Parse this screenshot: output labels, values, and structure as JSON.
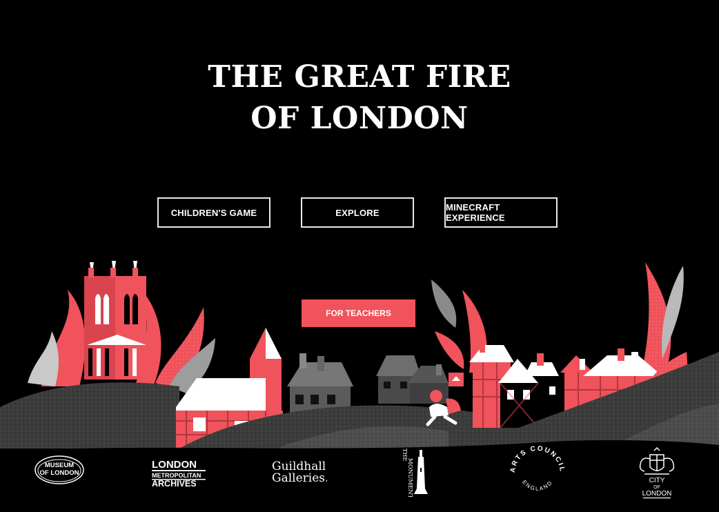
{
  "title": {
    "line1": "THE GREAT FIRE",
    "line2": "OF LONDON"
  },
  "nav": {
    "childrens_game": "CHILDREN'S GAME",
    "explore": "EXPLORE",
    "minecraft": "MINECRAFT EXPERIENCE"
  },
  "teachers": {
    "label": "FOR TEACHERS"
  },
  "colors": {
    "accent": "#f0535c",
    "background": "#000000",
    "hill": "#3a3a3a"
  },
  "logos": {
    "museum_line1": "MUSEUM",
    "museum_line2": "OF LONDON",
    "lma_line1": "LONDON",
    "lma_line2": "METROPOLITAN",
    "lma_line3": "ARCHIVES",
    "guildhall_line1": "Guildhall",
    "guildhall_line2": "Galleries.",
    "monument_line1": "THE",
    "monument_line2": "MONUMENT",
    "arts_council_top": "ARTS COUNCIL",
    "arts_council_bottom": "ENGLAND",
    "city_line1": "CITY",
    "city_line2": "OF",
    "city_line3": "LONDON"
  }
}
